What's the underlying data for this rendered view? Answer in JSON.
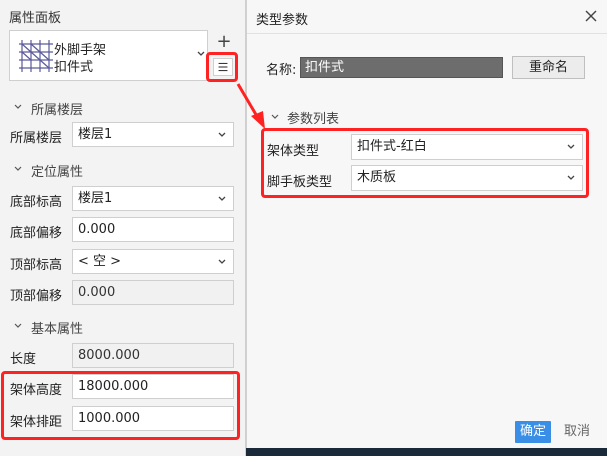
{
  "panel": {
    "title": "属性面板",
    "type_name_line1": "外脚手架",
    "type_name_line2": "扣件式",
    "add_label": "+",
    "sections": [
      {
        "label": "所属楼层"
      },
      {
        "label": "定位属性"
      },
      {
        "label": "基本属性"
      }
    ],
    "floor": {
      "label": "所属楼层",
      "value": "楼层1"
    },
    "base_level": {
      "label": "底部标高",
      "value": "楼层1"
    },
    "base_offset": {
      "label": "底部偏移",
      "value": "0.000"
    },
    "top_level": {
      "label": "顶部标高",
      "value": "< 空 >"
    },
    "top_offset": {
      "label": "顶部偏移",
      "value": "0.000"
    },
    "length": {
      "label": "长度",
      "value": "8000.000"
    },
    "frame_height": {
      "label": "架体高度",
      "value": "18000.000"
    },
    "frame_spacing": {
      "label": "架体排距",
      "value": "1000.000"
    }
  },
  "dialog": {
    "title": "类型参数",
    "name_label": "名称:",
    "name_value": "扣件式",
    "rename_label": "重命名",
    "param_list_label": "参数列表",
    "params": [
      {
        "label": "架体类型",
        "value": "扣件式-红白"
      },
      {
        "label": "脚手板类型",
        "value": "木质板"
      }
    ],
    "ok_label": "确定",
    "cancel_label": "取消"
  },
  "colors": {
    "highlight": "#ff2222",
    "primary_button": "#3a8ee6",
    "name_field_bg": "#6d6d6d"
  }
}
